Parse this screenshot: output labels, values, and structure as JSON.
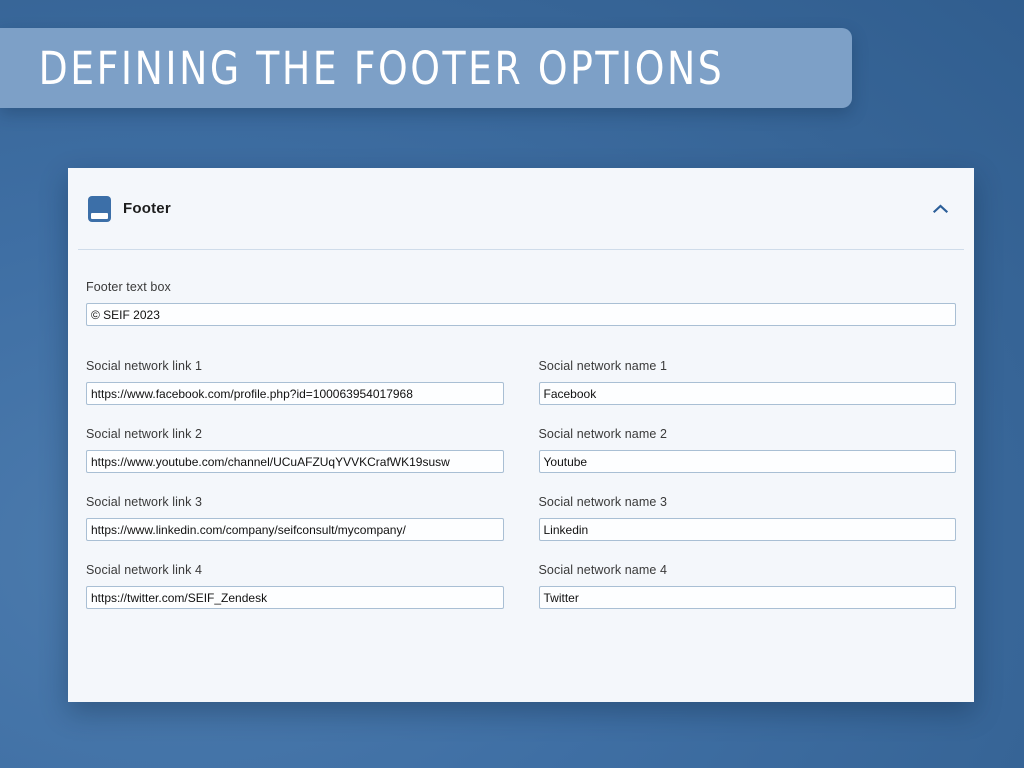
{
  "banner": {
    "title": "DEFINING THE FOOTER OPTIONS"
  },
  "card": {
    "header": {
      "title": "Footer",
      "icon": "footer-layout-icon",
      "collapse_icon": "chevron-up-icon"
    },
    "footer_text": {
      "label": "Footer text box",
      "value": "© SEIF 2023",
      "placeholder": ""
    },
    "fields": [
      {
        "link_label": "Social network link 1",
        "link_value": "https://www.facebook.com/profile.php?id=100063954017968",
        "name_label": "Social network name 1",
        "name_value": "Facebook"
      },
      {
        "link_label": "Social network link 2",
        "link_value": "https://www.youtube.com/channel/UCuAFZUqYVVKCrafWK19susw",
        "name_label": "Social network name 2",
        "name_value": "Youtube"
      },
      {
        "link_label": "Social network link 3",
        "link_value": "https://www.linkedin.com/company/seifconsult/mycompany/",
        "name_label": "Social network name 3",
        "name_value": "Linkedin"
      },
      {
        "link_label": "Social network link 4",
        "link_value": "https://twitter.com/SEIF_Zendesk",
        "name_label": "Social network name 4",
        "name_value": "Twitter"
      }
    ]
  },
  "colors": {
    "page_background": "#3b6ea5",
    "banner_fill": "#7da0c7",
    "card_background": "#f4f7fb",
    "accent": "#3c6fa8",
    "input_border": "#a9bfd4",
    "divider": "#cfdcea"
  }
}
